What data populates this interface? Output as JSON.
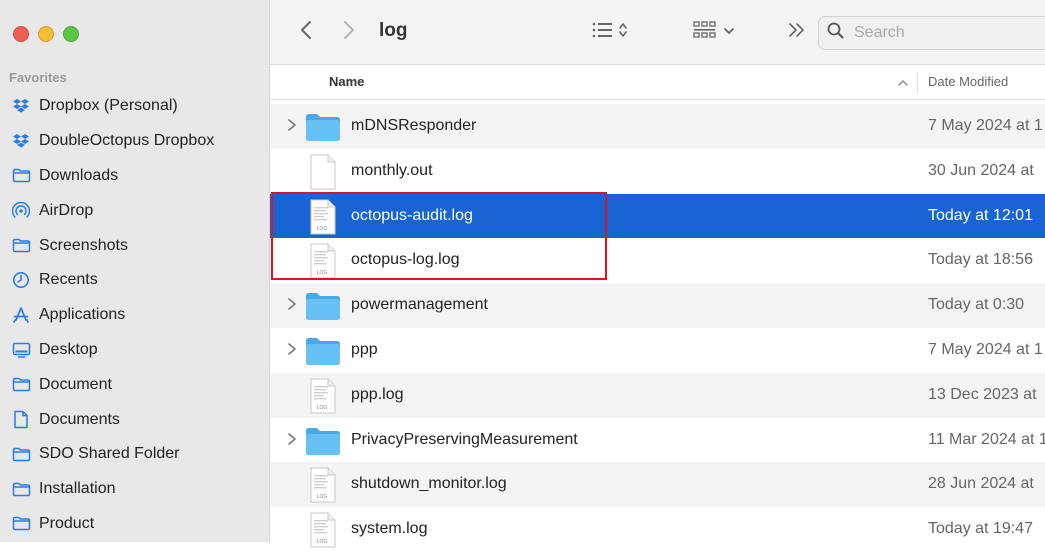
{
  "sidebar": {
    "heading": "Favorites",
    "items": [
      {
        "label": "Dropbox (Personal)",
        "icon": "dropbox-icon"
      },
      {
        "label": "DoubleOctopus Dropbox",
        "icon": "dropbox-icon"
      },
      {
        "label": "Downloads",
        "icon": "folder-icon"
      },
      {
        "label": "AirDrop",
        "icon": "airdrop-icon"
      },
      {
        "label": "Screenshots",
        "icon": "folder-icon"
      },
      {
        "label": "Recents",
        "icon": "clock-icon"
      },
      {
        "label": "Applications",
        "icon": "applications-icon"
      },
      {
        "label": "Desktop",
        "icon": "desktop-icon"
      },
      {
        "label": "Document",
        "icon": "folder-icon"
      },
      {
        "label": "Documents",
        "icon": "document-icon"
      },
      {
        "label": "SDO Shared Folder",
        "icon": "folder-icon"
      },
      {
        "label": "Installation",
        "icon": "folder-icon"
      },
      {
        "label": "Product",
        "icon": "folder-icon"
      }
    ]
  },
  "toolbar": {
    "title": "log",
    "search_placeholder": "Search"
  },
  "columns": {
    "name": "Name",
    "date_modified": "Date Modified"
  },
  "files": [
    {
      "name": "mDNSResponder",
      "date": "7 May 2024 at 1",
      "type": "folder",
      "selected": false
    },
    {
      "name": "monthly.out",
      "date": "30 Jun 2024 at",
      "type": "file",
      "selected": false
    },
    {
      "name": "octopus-audit.log",
      "date": "Today at 12:01",
      "type": "log",
      "selected": true
    },
    {
      "name": "octopus-log.log",
      "date": "Today at 18:56",
      "type": "log",
      "selected": false
    },
    {
      "name": "powermanagement",
      "date": "Today at 0:30",
      "type": "folder",
      "selected": false
    },
    {
      "name": "ppp",
      "date": "7 May 2024 at 1",
      "type": "folder",
      "selected": false
    },
    {
      "name": "ppp.log",
      "date": "13 Dec 2023 at",
      "type": "log",
      "selected": false
    },
    {
      "name": "PrivacyPreservingMeasurement",
      "date": "11 Mar 2024 at 1",
      "type": "folder",
      "selected": false
    },
    {
      "name": "shutdown_monitor.log",
      "date": "28 Jun 2024 at",
      "type": "log",
      "selected": false
    },
    {
      "name": "system.log",
      "date": "Today at 19:47",
      "type": "log",
      "selected": false
    }
  ],
  "colors": {
    "selection": "#1a63d4",
    "folder": "#5ab7f0",
    "highlight_box": "#d6191f",
    "sidebar_icon": "#2c7be5"
  }
}
